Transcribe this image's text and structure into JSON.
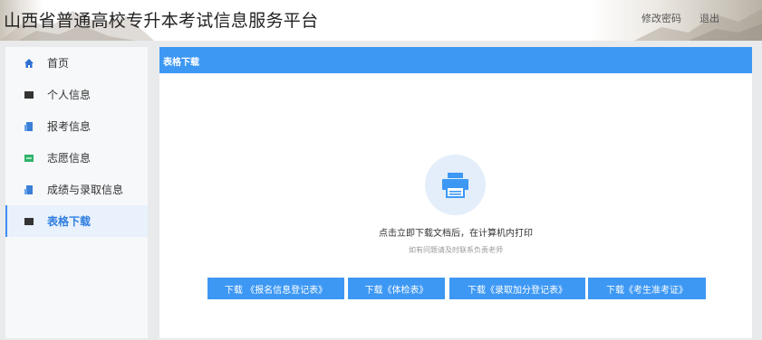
{
  "header": {
    "site_title": "山西省普通高校专升本考试信息服务平台",
    "change_password": "修改密码",
    "logout": "退出"
  },
  "sidebar": {
    "items": [
      {
        "label": "首页",
        "icon": "home-icon",
        "color": "#2d6fd0"
      },
      {
        "label": "个人信息",
        "icon": "person-card-icon",
        "color": "#333333"
      },
      {
        "label": "报考信息",
        "icon": "document-icon",
        "color": "#3b7fd6"
      },
      {
        "label": "志愿信息",
        "icon": "flag-icon",
        "color": "#2fb36a"
      },
      {
        "label": "成绩与录取信息",
        "icon": "chart-icon",
        "color": "#3b7fd6"
      },
      {
        "label": "表格下载",
        "icon": "table-icon",
        "color": "#333333",
        "active": true
      }
    ]
  },
  "main": {
    "section_title": "表格下载",
    "hint_main": "点击立即下载文档后，在计算机内打印",
    "hint_sub": "如有问题请及时联系负责老师",
    "buttons": [
      "下载 《报名信息登记表》",
      "下载《体检表》",
      "下载《录取加分登记表》",
      "下载《考生准考证》"
    ]
  },
  "colors": {
    "accent": "#3d98f4",
    "active_bg": "#e8f1fc",
    "page_bg": "#e9eaec"
  }
}
